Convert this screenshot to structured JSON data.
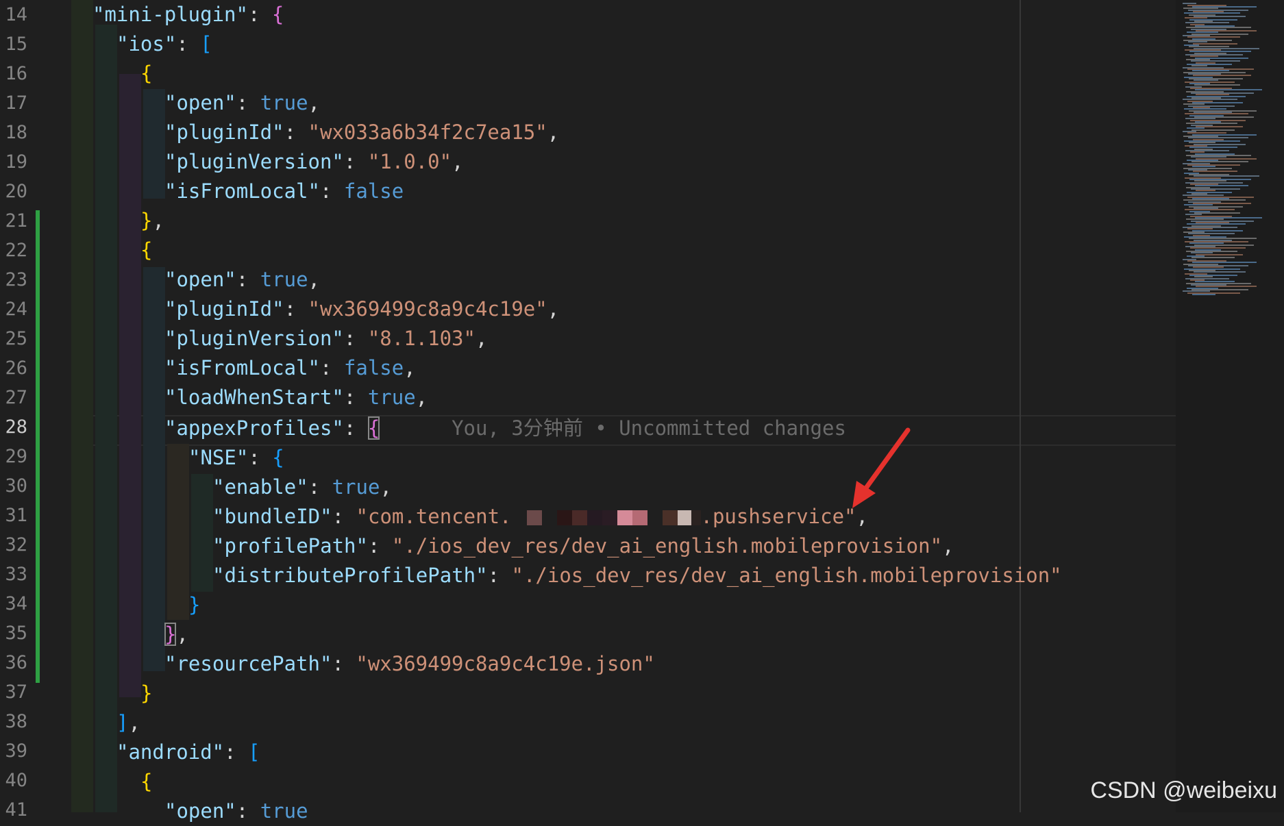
{
  "line_numbers": [
    "14",
    "15",
    "16",
    "17",
    "18",
    "19",
    "20",
    "21",
    "22",
    "23",
    "24",
    "25",
    "26",
    "27",
    "28",
    "29",
    "30",
    "31",
    "32",
    "33",
    "34",
    "35",
    "36",
    "37",
    "38",
    "39",
    "40",
    "41"
  ],
  "code": {
    "l14_key": "\"mini-plugin\"",
    "l14_sep": ": ",
    "l14_open": "{",
    "l15_key": "\"ios\"",
    "l15_sep": ": ",
    "l15_open": "[",
    "l16_open": "{",
    "l17_key": "\"open\"",
    "l17_sep": ": ",
    "l17_val": "true",
    "l17_end": ",",
    "l18_key": "\"pluginId\"",
    "l18_sep": ": ",
    "l18_val": "\"wx033a6b34f2c7ea15\"",
    "l18_end": ",",
    "l19_key": "\"pluginVersion\"",
    "l19_sep": ": ",
    "l19_val": "\"1.0.0\"",
    "l19_end": ",",
    "l20_key": "\"isFromLocal\"",
    "l20_sep": ": ",
    "l20_val": "false",
    "l21_close": "}",
    "l21_end": ",",
    "l22_open": "{",
    "l23_key": "\"open\"",
    "l23_sep": ": ",
    "l23_val": "true",
    "l23_end": ",",
    "l24_key": "\"pluginId\"",
    "l24_sep": ": ",
    "l24_val": "\"wx369499c8a9c4c19e\"",
    "l24_end": ",",
    "l25_key": "\"pluginVersion\"",
    "l25_sep": ": ",
    "l25_val": "\"8.1.103\"",
    "l25_end": ",",
    "l26_key": "\"isFromLocal\"",
    "l26_sep": ": ",
    "l26_val": "false",
    "l26_end": ",",
    "l27_key": "\"loadWhenStart\"",
    "l27_sep": ": ",
    "l27_val": "true",
    "l27_end": ",",
    "l28_key": "\"appexProfiles\"",
    "l28_sep": ": ",
    "l28_open": "{",
    "l28_blame": "You, 3分钟前 • Uncommitted changes",
    "l29_key": "\"NSE\"",
    "l29_sep": ": ",
    "l29_open": "{",
    "l30_key": "\"enable\"",
    "l30_sep": ": ",
    "l30_val": "true",
    "l30_end": ",",
    "l31_key": "\"bundleID\"",
    "l31_sep": ": ",
    "l31_val_start": "\"com.tencent.",
    "l31_val_end": ".pushservice\"",
    "l31_end": ",",
    "l32_key": "\"profilePath\"",
    "l32_sep": ": ",
    "l32_val": "\"./ios_dev_res/dev_ai_english.mobileprovision\"",
    "l32_end": ",",
    "l33_key": "\"distributeProfilePath\"",
    "l33_sep": ": ",
    "l33_val": "\"./ios_dev_res/dev_ai_english.mobileprovision\"",
    "l34_close": "}",
    "l35_close": "}",
    "l35_end": ",",
    "l36_key": "\"resourcePath\"",
    "l36_sep": ": ",
    "l36_val": "\"wx369499c8a9c4c19e.json\"",
    "l37_close": "}",
    "l38_close": "]",
    "l38_end": ",",
    "l39_key": "\"android\"",
    "l39_sep": ": ",
    "l39_open": "[",
    "l40_open": "{",
    "l41_key": "\"open\"",
    "l41_sep": ": ",
    "l41_val": "true"
  },
  "watermark": "CSDN @weibeixu",
  "colors": {
    "background": "#1f1f1f",
    "json_key": "#9cdcfe",
    "string": "#ce9178",
    "keyword": "#569cd6",
    "bracket_level1": "#ffd700",
    "bracket_level2": "#da70d6",
    "bracket_level3": "#179fff",
    "git_added": "#2ea043",
    "arrow": "#e5322d"
  },
  "icons": [
    "red-arrow-annotation"
  ]
}
